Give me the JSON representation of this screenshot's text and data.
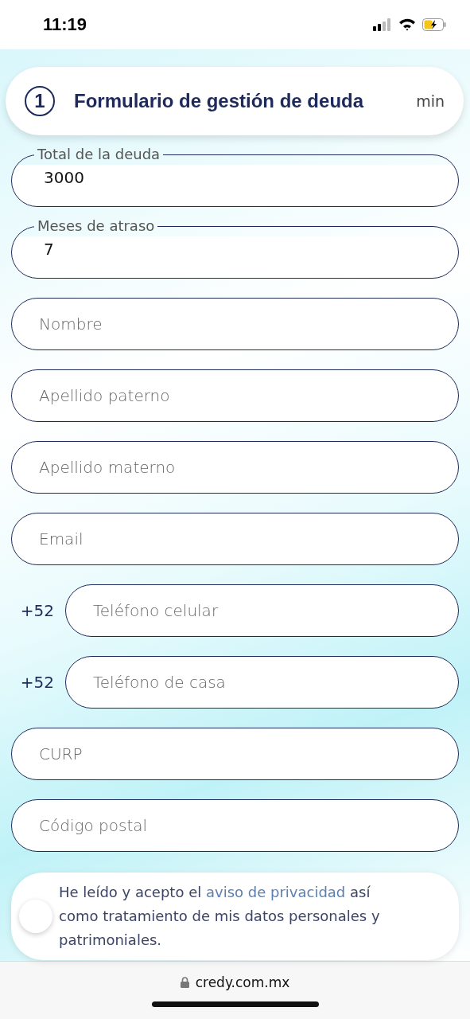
{
  "status_bar": {
    "time": "11:19"
  },
  "header": {
    "step": "1",
    "title": "Formulario de gestión de deuda",
    "duration": "min"
  },
  "fields": [
    {
      "kind": "filled",
      "label": "Total de la deuda",
      "value": "3000"
    },
    {
      "kind": "filled",
      "label": "Meses de atraso",
      "value": "7"
    },
    {
      "kind": "text",
      "placeholder": "Nombre"
    },
    {
      "kind": "text",
      "placeholder": "Apellido paterno"
    },
    {
      "kind": "text",
      "placeholder": "Apellido materno"
    },
    {
      "kind": "text",
      "placeholder": "Email"
    },
    {
      "kind": "phone",
      "prefix": "+52",
      "placeholder": "Teléfono celular"
    },
    {
      "kind": "phone",
      "prefix": "+52",
      "placeholder": "Teléfono de casa"
    },
    {
      "kind": "text",
      "placeholder": "CURP"
    },
    {
      "kind": "text",
      "placeholder": "Código postal"
    }
  ],
  "consent": {
    "checked": false,
    "text_before": "He leído y acepto el",
    "link": "aviso de privacidad",
    "text_after": "así como tratamiento de mis datos personales y patrimoniales."
  },
  "browser_bar": {
    "url": "credy.com.mx"
  }
}
